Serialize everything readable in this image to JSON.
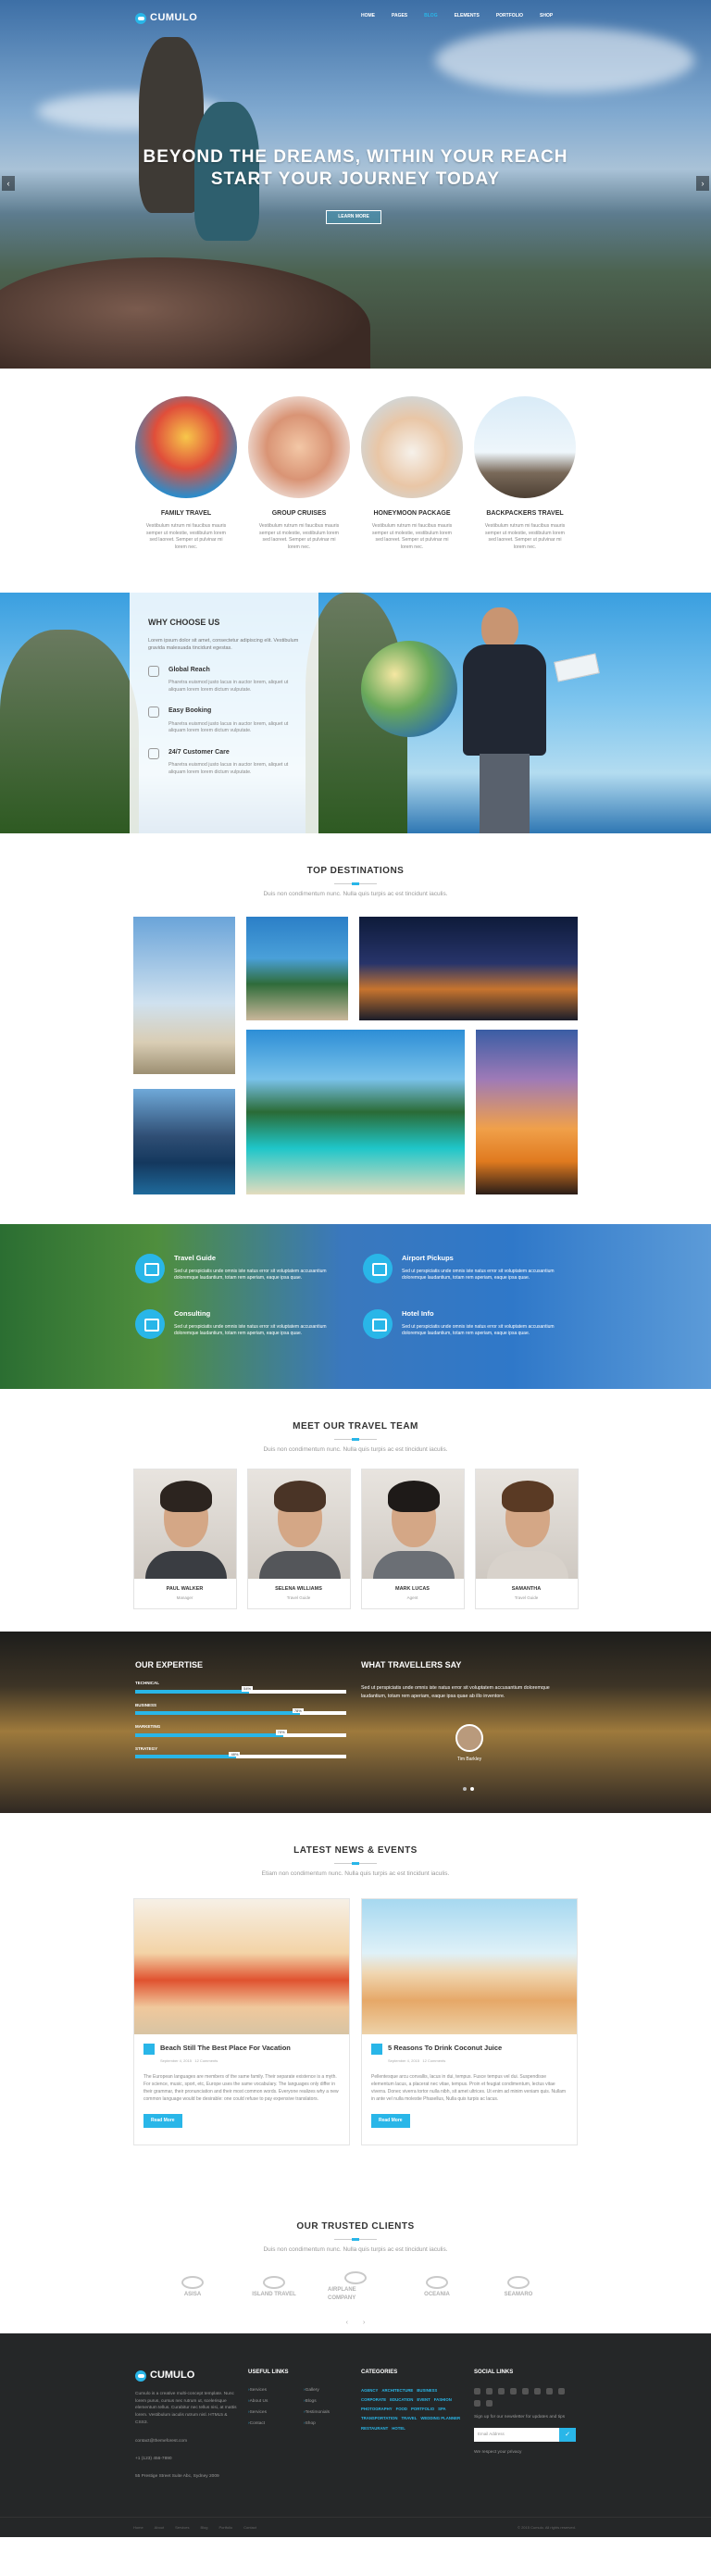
{
  "header": {
    "logo": "CUMULO",
    "menu": [
      "HOME",
      "PAGES",
      "BLOG",
      "ELEMENTS",
      "PORTFOLIO",
      "SHOP"
    ],
    "active_menu": "BLOG"
  },
  "hero": {
    "line1": "BEYOND THE DREAMS, WITHIN YOUR REACH",
    "line2": "START YOUR JOURNEY TODAY",
    "button": "LEARN MORE",
    "prev": "‹",
    "next": "›"
  },
  "services": [
    {
      "title": "FAMILY TRAVEL",
      "text": "Vestibulum rutrum mi faucibus mauris semper ut molestie, vestibulum lorem sed laoreet. Semper ut pulvinar mi lorem nec."
    },
    {
      "title": "GROUP CRUISES",
      "text": "Vestibulum rutrum mi faucibus mauris semper ut molestie, vestibulum lorem sed laoreet. Semper ut pulvinar mi lorem nec."
    },
    {
      "title": "HONEYMOON PACKAGE",
      "text": "Vestibulum rutrum mi faucibus mauris semper ut molestie, vestibulum lorem sed laoreet. Semper ut pulvinar mi lorem nec."
    },
    {
      "title": "BACKPACKERS TRAVEL",
      "text": "Vestibulum rutrum mi faucibus mauris semper ut molestie, vestibulum lorem sed laoreet. Semper ut pulvinar mi lorem nec."
    }
  ],
  "why": {
    "title": "WHY CHOOSE US",
    "intro": "Lorem ipsum dolor sit amet, consectetur adipiscing elit. Vestibulum gravida malesuada tincidunt egestas.",
    "items": [
      {
        "title": "Global Reach",
        "text": "Pharetra euismod justo lacus in auctor lorem, aliquet ut aliquam lorem lorem dictum vulputate."
      },
      {
        "title": "Easy Booking",
        "text": "Pharetra euismod justo lacus in auctor lorem, aliquet ut aliquam lorem lorem dictum vulputate."
      },
      {
        "title": "24/7 Customer Care",
        "text": "Pharetra euismod justo lacus in auctor lorem, aliquet ut aliquam lorem lorem dictum vulputate."
      }
    ]
  },
  "destinations": {
    "title": "TOP DESTINATIONS",
    "subtitle": "Duis non condimentum nunc. Nulla quis turpis ac est tincidunt iaculis."
  },
  "features": [
    {
      "title": "Travel Guide",
      "text": "Sed ut perspiciatis unde omnis iste natus error sit voluptatem accusantium doloremque laudantium, totam rem aperiam, eaque ipsa quae."
    },
    {
      "title": "Airport Pickups",
      "text": "Sed ut perspiciatis unde omnis iste natus error sit voluptatem accusantium doloremque laudantium, totam rem aperiam, eaque ipsa quae."
    },
    {
      "title": "Consulting",
      "text": "Sed ut perspiciatis unde omnis iste natus error sit voluptatem accusantium doloremque laudantium, totam rem aperiam, eaque ipsa quae."
    },
    {
      "title": "Hotel Info",
      "text": "Sed ut perspiciatis unde omnis iste natus error sit voluptatem accusantium doloremque laudantium, totam rem aperiam, eaque ipsa quae."
    }
  ],
  "team": {
    "title": "MEET OUR TRAVEL TEAM",
    "subtitle": "Duis non condimentum nunc. Nulla quis turpis ac est tincidunt iaculis.",
    "members": [
      {
        "name": "PAUL WALKER",
        "role": "Manager"
      },
      {
        "name": "SELENA WILLIAMS",
        "role": "Travel Guide"
      },
      {
        "name": "MARK LUCAS",
        "role": "Agent"
      },
      {
        "name": "SAMANTHA",
        "role": "Travel Guide"
      }
    ]
  },
  "expertise": {
    "title": "OUR EXPERTISE",
    "skills": [
      {
        "label": "TECHNICAL",
        "percent": 54
      },
      {
        "label": "BUSINESS",
        "percent": 78
      },
      {
        "label": "MARKETING",
        "percent": 70
      },
      {
        "label": "STRATEGY",
        "percent": 48
      }
    ]
  },
  "testimonial": {
    "title": "WHAT TRAVELLERS SAY",
    "quote": "Sed ut perspiciatis unde omnis iste natus error sit voluptatem accusantium doloremque laudantium, totam rem aperiam, eaque ipsa quae ab illo inventore.",
    "name": "Tim Barkley"
  },
  "news": {
    "title": "LATEST NEWS & EVENTS",
    "subtitle": "Etiam non condimentum nunc. Nulla quis turpis ac est tincidunt iaculis.",
    "posts": [
      {
        "title": "Beach Still The Best Place For Vacation",
        "meta1": "September 4, 2015",
        "meta2": "12 Comments",
        "text": "The European languages are members of the same family. Their separate existence is a myth. For science, music, sport, etc, Europe uses the same vocabulary. The languages only differ in their grammar, their pronunciation and their most common words. Everyone realizes why a new common language would be desirable: one could refuse to pay expensive translators.",
        "button": "Read More"
      },
      {
        "title": "5 Reasons To Drink Coconut Juice",
        "meta1": "September 4, 2015",
        "meta2": "12 Comments",
        "text": "Pellentesque arcu convallis, lacus in dui, tempus. Fusce tempus vel dui. Suspendisse elementum lacus, a placerat nec vitae, tempus. Proin et feugiat condimentum, lectus vitae viverra. Donec viverra tortor nulla nibh, sit amet ultrices. Ut enim ad minim veniam quis. Nullam in ante vel nulla molestie Phasellus, Nulla quis turpis ac lacus.",
        "button": "Read More"
      }
    ]
  },
  "clients": {
    "title": "OUR TRUSTED CLIENTS",
    "subtitle": "Duis non condimentum nunc. Nulla quis turpis ac est tincidunt iaculis.",
    "logos": [
      "ASISA",
      "ISLAND TRAVEL",
      "AIRPLANE COMPANY",
      "OCEANIA",
      "SEAMARO"
    ],
    "prev": "‹",
    "next": "›"
  },
  "footer": {
    "logo": "CUMULO",
    "about": "Cumulo is a creative multi-concept template. Nunc lorem purus, cursus nec rutrum ut, scelerisque elementum tellus. Curabitur nec tellus nisi, at mattis lorem. Vestibulum iaculis rutrum nisl. HTML5 & CSS3.",
    "email": "contact@themeforest.com",
    "phone": "+1 (123) 456-7890",
    "address": "55 Prestige Street Suite Abc, Sydney 2009",
    "useful_title": "USEFUL LINKS",
    "useful": [
      "Services",
      "Gallery",
      "About Us",
      "Blogs",
      "Services",
      "Testimonials",
      "Contact",
      "Shop"
    ],
    "categories_title": "CATEGORIES",
    "categories": [
      "Agency",
      "Architecture",
      "Business",
      "Corporate",
      "Education",
      "Event",
      "Fashion",
      "Photography",
      "Food",
      "Portfolio",
      "Spa",
      "Transportation",
      "Travel",
      "Wedding Planner",
      "Restaurant",
      "Hotel"
    ],
    "social_title": "SOCIAL LINKS",
    "social_text": "Sign up for our newsletter for updates and tips",
    "newsletter_placeholder": "Email Address",
    "newsletter_button": "✓",
    "no_spam": "We respect your privacy",
    "bottom_links": [
      "Home",
      "About",
      "Services",
      "Blog",
      "Portfolio",
      "Contact"
    ],
    "copyright": "© 2015 Cumulo. All rights reserved."
  },
  "colors": {
    "accent": "#29b6e8",
    "footer": "#252728"
  }
}
